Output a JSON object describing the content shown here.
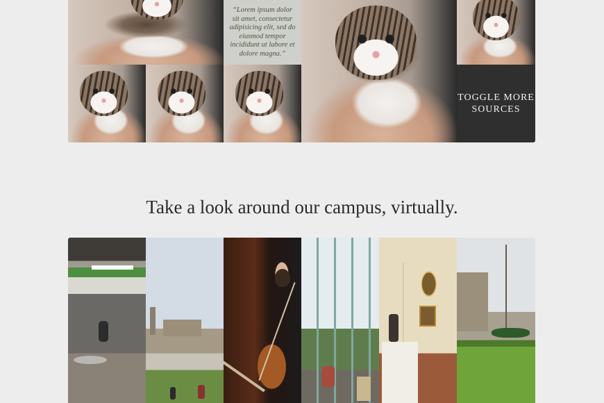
{
  "quote_text": "“Lorem ipsum dolor sit amet, consectetur adipisicing elit, sed do eiusmod tempor incididunt ut labore et dolore magna.”",
  "toggle_label": "TOGGLE MORE SOURCES",
  "campus_heading": "Take a look around our campus, virtually.",
  "colors": {
    "page_background": "#ededed",
    "toggle_background": "#2f2f2f",
    "quote_background": "#cfcfcb",
    "quote_text": "#4a5a3e",
    "heading_text": "#2a2a2a"
  },
  "top_grid": [
    {
      "type": "kitten-photo"
    },
    {
      "type": "quote"
    },
    {
      "type": "kitten-photo-large"
    },
    {
      "type": "kitten-photo"
    },
    {
      "type": "kitten-photo"
    },
    {
      "type": "kitten-photo"
    },
    {
      "type": "kitten-photo"
    },
    {
      "type": "toggle-button"
    }
  ],
  "campus_photos": [
    {
      "icon": "library-photo"
    },
    {
      "icon": "castle-photo"
    },
    {
      "icon": "cellist-photo"
    },
    {
      "icon": "atrium-photo"
    },
    {
      "icon": "museum-photo"
    },
    {
      "icon": "campus-lawn-photo"
    }
  ]
}
